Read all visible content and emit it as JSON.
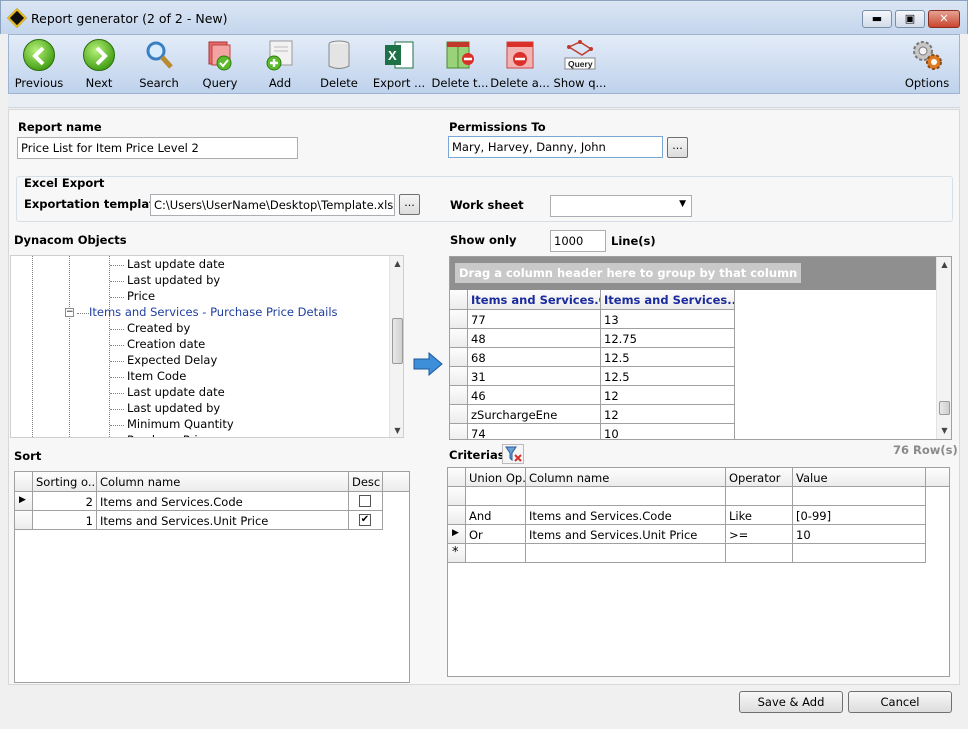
{
  "window": {
    "title": "Report generator (2 of 2 - New)",
    "min": "▬",
    "max": "▣",
    "close": "✕"
  },
  "toolbar": {
    "buttons": [
      {
        "label": "Previous",
        "icon": "previous-icon"
      },
      {
        "label": "Next",
        "icon": "next-icon"
      },
      {
        "label": "Search",
        "icon": "search-icon"
      },
      {
        "label": "Query",
        "icon": "query-icon"
      },
      {
        "label": "Add",
        "icon": "add-icon"
      },
      {
        "label": "Delete",
        "icon": "delete-icon"
      },
      {
        "label": "Export ...",
        "icon": "excel-export-icon"
      },
      {
        "label": "Delete t...",
        "icon": "delete-table-icon"
      },
      {
        "label": "Delete a...",
        "icon": "delete-all-icon"
      },
      {
        "label": "Show q...",
        "icon": "show-query-icon"
      },
      {
        "label": "Options",
        "icon": "options-icon"
      }
    ],
    "query_badge": "Query"
  },
  "report": {
    "name_label": "Report name",
    "name_value": "Price List for Item Price Level 2",
    "permissions_label": "Permissions To",
    "permissions_value": "Mary, Harvey, Danny, John",
    "ellipsis": "..."
  },
  "excel": {
    "group_label": "Excel Export",
    "template_label": "Exportation template",
    "template_value": "C:\\Users\\UserName\\Desktop\\Template.xlsx",
    "worksheet_label": "Work sheet",
    "worksheet_value": ""
  },
  "objects": {
    "label": "Dynacom Objects",
    "tree": [
      {
        "text": "Last update date",
        "level": 2
      },
      {
        "text": "Last updated by",
        "level": 2
      },
      {
        "text": "Price",
        "level": 2
      },
      {
        "text": "Items and Services - Purchase Price Details",
        "level": 1
      },
      {
        "text": "Created by",
        "level": 2
      },
      {
        "text": "Creation date",
        "level": 2
      },
      {
        "text": "Expected Delay",
        "level": 2
      },
      {
        "text": "Item Code",
        "level": 2
      },
      {
        "text": "Last update date",
        "level": 2
      },
      {
        "text": "Last updated by",
        "level": 2
      },
      {
        "text": "Minimum Quantity",
        "level": 2
      },
      {
        "text": "Purchase Price",
        "level": 2
      }
    ],
    "collapse_glyph": "−"
  },
  "preview": {
    "show_only_label": "Show only",
    "show_only_value": "1000",
    "lines_label": "Line(s)",
    "group_hint": "Drag a column header here to group by that column",
    "columns": [
      "Items and Services.C...",
      "Items and Services...."
    ],
    "rows": [
      [
        "77",
        "13"
      ],
      [
        "48",
        "12.75"
      ],
      [
        "68",
        "12.5"
      ],
      [
        "31",
        "12.5"
      ],
      [
        "46",
        "12"
      ],
      [
        "zSurchargeEne",
        "12"
      ],
      [
        "74",
        "10"
      ]
    ],
    "row_count": "76 Row(s)"
  },
  "sort": {
    "label": "Sort",
    "columns": [
      "Sorting o...",
      "Column name",
      "Desc"
    ],
    "rows": [
      {
        "order": "2",
        "column": "Items and Services.Code",
        "desc": false
      },
      {
        "order": "1",
        "column": "Items and Services.Unit Price",
        "desc": true
      }
    ]
  },
  "criteria": {
    "label": "Criterias",
    "columns": [
      "Union Op.",
      "Column name",
      "Operator",
      "Value"
    ],
    "rows": [
      {
        "union": "",
        "column": "",
        "operator": "",
        "value": ""
      },
      {
        "union": "And",
        "column": "Items and Services.Code",
        "operator": "Like",
        "value": "[0-99]"
      },
      {
        "union": "Or",
        "column": "Items and Services.Unit Price",
        "operator": ">=",
        "value": "10"
      }
    ],
    "new_row_marker": "*"
  },
  "footer": {
    "save_add": "Save & Add",
    "cancel": "Cancel"
  },
  "colors": {
    "toolbar_top": "#e3ecf8",
    "toolbar_bottom": "#bfd2ec",
    "tree_blue": "#1f3f9e",
    "header_blue": "#1a2b9e"
  }
}
